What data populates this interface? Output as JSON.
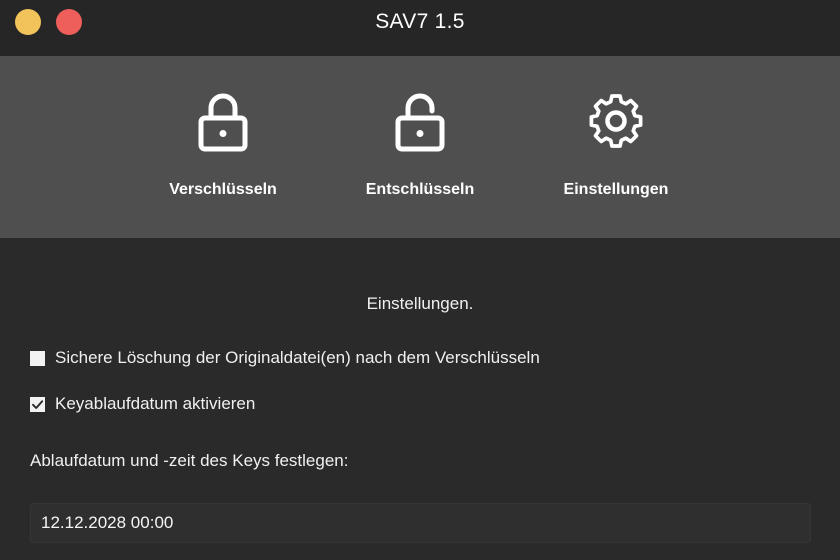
{
  "window": {
    "title": "SAV7 1.5"
  },
  "toolbar": {
    "items": [
      {
        "label": "Verschlüsseln",
        "icon": "lock-closed-icon"
      },
      {
        "label": "Entschlüsseln",
        "icon": "lock-open-icon"
      },
      {
        "label": "Einstellungen",
        "icon": "gear-icon"
      }
    ]
  },
  "settings": {
    "heading": "Einstellungen.",
    "options": [
      {
        "label": "Sichere Löschung der Originaldatei(en) nach dem Verschlüsseln",
        "checked": false
      },
      {
        "label": "Keyablaufdatum aktivieren",
        "checked": true
      }
    ],
    "expiry_label": "Ablaufdatum und -zeit des Keys festlegen:",
    "expiry_value": "12.12.2028 00:00"
  },
  "colors": {
    "window_bg": "#2a2a2a",
    "titlebar_bg": "#262626",
    "toolbar_bg": "#4f4f4f",
    "traffic_yellow": "#f2c35a",
    "traffic_red": "#ee5f5b",
    "text": "#f0f0f0"
  }
}
